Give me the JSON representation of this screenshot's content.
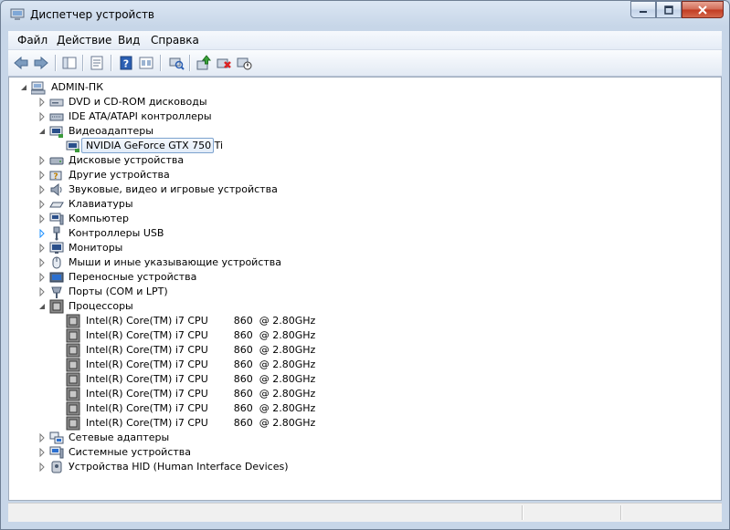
{
  "window": {
    "title": "Диспетчер устройств"
  },
  "menu": [
    "Файл",
    "Действие",
    "Вид",
    "Справка"
  ],
  "toolbar": {
    "icons": [
      "back-arrow-icon",
      "forward-arrow-icon",
      "console-tree-icon",
      "properties-icon",
      "help-icon",
      "show-hidden-icon",
      "scan-hardware-icon",
      "update-driver-icon",
      "uninstall-device-icon",
      "disable-device-icon"
    ]
  },
  "tree": {
    "root": "ADMIN-ПК",
    "categories": [
      "DVD и CD-ROM дисководы",
      "IDE ATA/ATAPI контроллеры",
      "Видеоадаптеры",
      "Дисковые устройства",
      "Другие устройства",
      "Звуковые, видео и игровые устройства",
      "Клавиатуры",
      "Компьютер",
      "Контроллеры USB",
      "Мониторы",
      "Мыши и иные указывающие устройства",
      "Переносные устройства",
      "Порты (COM и LPT)",
      "Процессоры",
      "Сетевые адаптеры",
      "Системные устройства",
      "Устройства HID (Human Interface Devices)"
    ],
    "video_device": "NVIDIA GeForce GTX 750 Ti",
    "processors": [
      "Intel(R) Core(TM) i7 CPU        860  @ 2.80GHz",
      "Intel(R) Core(TM) i7 CPU        860  @ 2.80GHz",
      "Intel(R) Core(TM) i7 CPU        860  @ 2.80GHz",
      "Intel(R) Core(TM) i7 CPU        860  @ 2.80GHz",
      "Intel(R) Core(TM) i7 CPU        860  @ 2.80GHz",
      "Intel(R) Core(TM) i7 CPU        860  @ 2.80GHz",
      "Intel(R) Core(TM) i7 CPU        860  @ 2.80GHz",
      "Intel(R) Core(TM) i7 CPU        860  @ 2.80GHz"
    ]
  }
}
